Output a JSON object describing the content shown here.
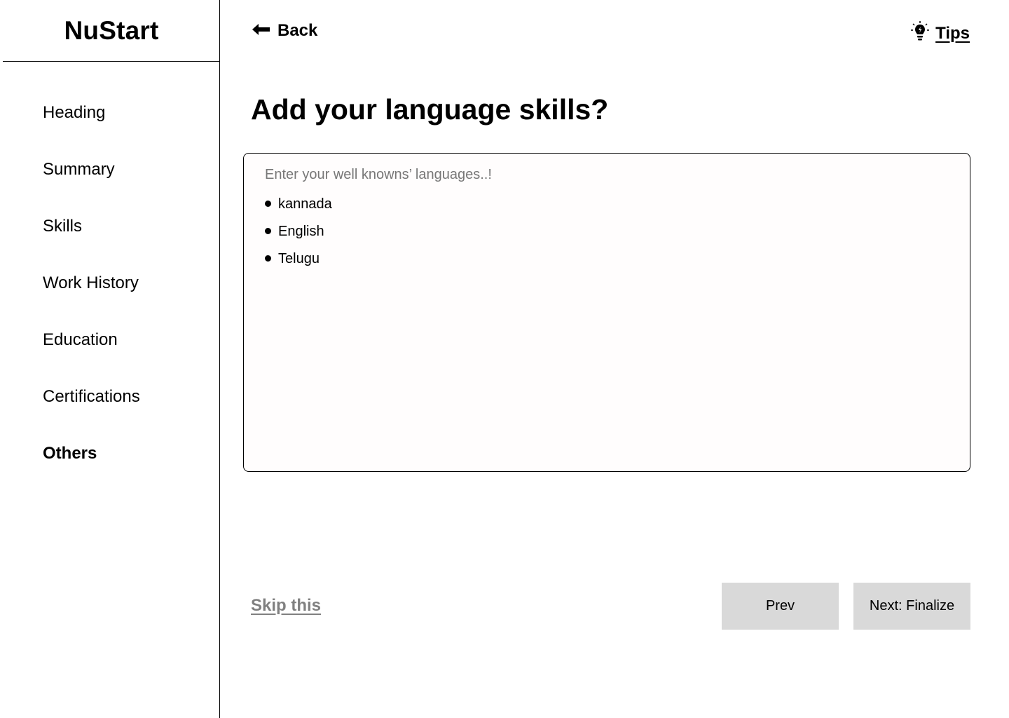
{
  "brand": {
    "name": "NuStart"
  },
  "sidebar": {
    "items": [
      {
        "label": "Heading",
        "active": false
      },
      {
        "label": "Summary",
        "active": false
      },
      {
        "label": "Skills",
        "active": false
      },
      {
        "label": "Work History",
        "active": false
      },
      {
        "label": "Education",
        "active": false
      },
      {
        "label": "Certifications",
        "active": false
      },
      {
        "label": "Others",
        "active": true
      }
    ]
  },
  "header": {
    "back_label": "Back",
    "back_icon": "arrow-left-icon",
    "tips_label": "Tips",
    "tips_icon": "lightbulb-icon"
  },
  "main": {
    "title": "Add your language skills?",
    "editor": {
      "placeholder": "Enter your well knowns’ languages..!",
      "items": [
        "kannada",
        "English",
        "Telugu"
      ]
    }
  },
  "footer": {
    "skip_label": "Skip this",
    "prev_label": "Prev",
    "next_label": "Next: Finalize"
  },
  "colors": {
    "button_bg": "#d9d9d9",
    "skip_text": "#808080",
    "placeholder_text": "#777777"
  }
}
